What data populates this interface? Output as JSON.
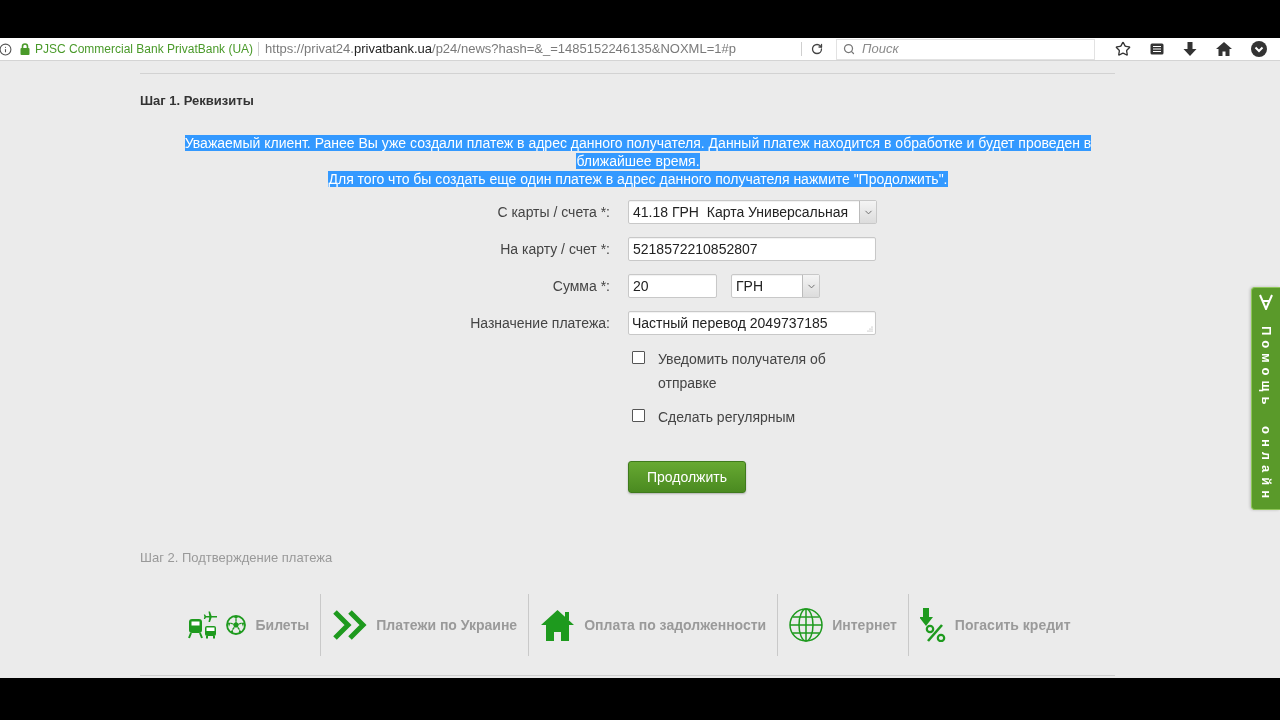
{
  "browser": {
    "site_identity": "PJSC Commercial Bank PrivatBank (UA)",
    "url": {
      "before": "https://privat24.",
      "domain": "privatbank.ua",
      "after": "/p24/news?hash=&_=1485152246135&NOXML=1#p"
    },
    "search": {
      "placeholder": "Поиск"
    }
  },
  "step_1": {
    "title": "Шаг 1. Реквизиты",
    "notice": {
      "selected": true,
      "lines": [
        "Уважаемый клиент. Ранее Вы уже создали платеж в адрес данного получателя. Данный платеж находится в обработке и будет проведен в ближайшее время.",
        "Для того что бы создать еще один платеж в адрес данного получателя нажмите \"Продолжить\"."
      ]
    },
    "fields": [
      {
        "kind": "select",
        "label": "С карты / счета *:",
        "value": "41.18 ГРН  Карта Универсальная"
      },
      {
        "kind": "input",
        "label": "На карту / счет *:",
        "value": "5218572210852807"
      },
      {
        "kind": "amount",
        "label": "Сумма *:",
        "value": "20",
        "currency": "ГРН"
      },
      {
        "kind": "textarea",
        "label": "Назначение платежа:",
        "value": "Частный перевод 2049737185"
      }
    ],
    "checkboxes": [
      {
        "label": "Уведомить получателя об отправке",
        "checked": false
      },
      {
        "label": "Сделать регулярным",
        "checked": false
      }
    ],
    "submit": "Продолжить"
  },
  "step_2": {
    "title": "Шаг 2. Подтверждение платежа"
  },
  "services": [
    {
      "kind": "tickets",
      "label": "Билеты"
    },
    {
      "kind": "payments",
      "label": "Платежи по Украине"
    },
    {
      "kind": "debt",
      "label": "Оплата по задолженности"
    },
    {
      "kind": "internet",
      "label": "Интернет"
    },
    {
      "kind": "credit",
      "label": "Погасить кредит"
    }
  ],
  "help_tab": {
    "label": "Помощь онлайн"
  }
}
